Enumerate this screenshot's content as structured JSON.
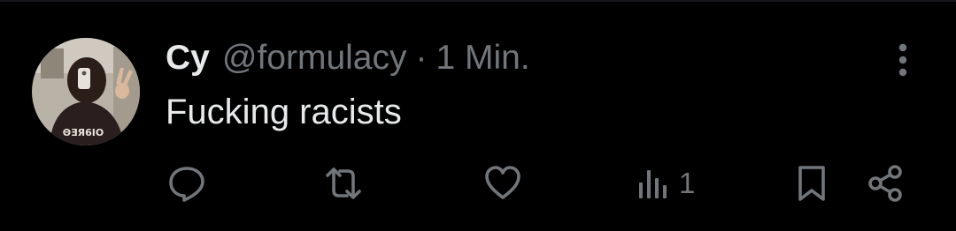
{
  "post": {
    "display_name": "Cy",
    "handle": "@formulacy",
    "separator": "·",
    "timestamp": "1 Min.",
    "text": "Fucking racists",
    "avatar_icon": "profile-photo",
    "more_icon": "vertical-dots-icon"
  },
  "actions": {
    "reply_icon": "reply-bubble-icon",
    "repost_icon": "repost-icon",
    "like_icon": "heart-icon",
    "views_icon": "bar-chart-icon",
    "views_count": "1",
    "bookmark_icon": "bookmark-icon",
    "share_icon": "share-icon"
  },
  "colors": {
    "background": "#000000",
    "primary_text": "#e7e9ea",
    "secondary_text": "#71767b"
  }
}
